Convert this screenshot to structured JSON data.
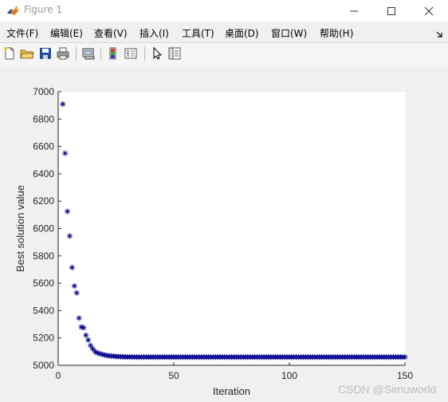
{
  "window": {
    "title": "Figure 1",
    "icon": "matlab-icon",
    "controls": [
      "minimize-icon",
      "maximize-icon",
      "close-icon"
    ]
  },
  "menubar": {
    "items": [
      {
        "label": "文件(F)"
      },
      {
        "label": "编辑(E)"
      },
      {
        "label": "查看(V)"
      },
      {
        "label": "插入(I)"
      },
      {
        "label": "工具(T)"
      },
      {
        "label": "桌面(D)"
      },
      {
        "label": "窗口(W)"
      },
      {
        "label": "帮助(H)"
      }
    ],
    "overflow_icon": "dock-arrow-icon"
  },
  "toolbar": {
    "buttons": [
      {
        "icon": "new-figure-icon"
      },
      {
        "icon": "open-file-icon"
      },
      {
        "icon": "save-icon"
      },
      {
        "icon": "print-icon"
      },
      {
        "icon": "link-plot-icon"
      },
      {
        "icon": "insert-colorbar-icon"
      },
      {
        "icon": "insert-legend-icon"
      },
      {
        "icon": "pointer-icon"
      },
      {
        "icon": "property-inspector-icon"
      }
    ]
  },
  "chart_data": {
    "type": "scatter",
    "marker": "*",
    "marker_color": "#00008b",
    "axes_background": "#ffffff",
    "xlabel": "Iteration",
    "ylabel": "Best solution value",
    "xlim": [
      0,
      150
    ],
    "ylim": [
      5000,
      7000
    ],
    "grid": false,
    "tick_labels": {
      "x": [
        "0",
        "50",
        "100",
        "150"
      ],
      "y": [
        "5000",
        "5200",
        "5400",
        "5600",
        "5800",
        "6000",
        "6200",
        "6400",
        "6600",
        "6800",
        "7000"
      ]
    },
    "series": [
      {
        "x": [
          2,
          3,
          4,
          5,
          6,
          7,
          8,
          9,
          10,
          11,
          12,
          13,
          14,
          15,
          16,
          17,
          18,
          19,
          20,
          21,
          22,
          23,
          24,
          25,
          26,
          27,
          28,
          29,
          30,
          31,
          32,
          33,
          34,
          35,
          36,
          37,
          38,
          39,
          40,
          41,
          42,
          43,
          44,
          45,
          46,
          47,
          48,
          49,
          50,
          51,
          52,
          53,
          54,
          55,
          56,
          57,
          58,
          59,
          60,
          61,
          62,
          63,
          64,
          65,
          66,
          67,
          68,
          69,
          70,
          71,
          72,
          73,
          74,
          75,
          76,
          77,
          78,
          79,
          80,
          81,
          82,
          83,
          84,
          85,
          86,
          87,
          88,
          89,
          90,
          91,
          92,
          93,
          94,
          95,
          96,
          97,
          98,
          99,
          100,
          101,
          102,
          103,
          104,
          105,
          106,
          107,
          108,
          109,
          110,
          111,
          112,
          113,
          114,
          115,
          116,
          117,
          118,
          119,
          120,
          121,
          122,
          123,
          124,
          125,
          126,
          127,
          128,
          129,
          130,
          131,
          132,
          133,
          134,
          135,
          136,
          137,
          138,
          139,
          140,
          141,
          142,
          143,
          144,
          145,
          146,
          147,
          148,
          149,
          150
        ],
        "y": [
          6910,
          6550,
          6125,
          5945,
          5715,
          5580,
          5530,
          5345,
          5280,
          5275,
          5220,
          5185,
          5145,
          5120,
          5100,
          5090,
          5085,
          5080,
          5076,
          5072,
          5070,
          5068,
          5066,
          5065,
          5064,
          5063,
          5062,
          5062,
          5061,
          5061,
          5061,
          5060,
          5060,
          5060,
          5060,
          5060,
          5060,
          5060,
          5060,
          5060,
          5060,
          5060,
          5060,
          5060,
          5060,
          5060,
          5060,
          5060,
          5060,
          5060,
          5060,
          5060,
          5060,
          5060,
          5060,
          5060,
          5060,
          5060,
          5060,
          5060,
          5060,
          5060,
          5060,
          5060,
          5060,
          5060,
          5060,
          5060,
          5060,
          5060,
          5060,
          5060,
          5060,
          5060,
          5060,
          5060,
          5060,
          5060,
          5060,
          5060,
          5060,
          5060,
          5060,
          5060,
          5060,
          5060,
          5060,
          5060,
          5060,
          5060,
          5060,
          5060,
          5060,
          5060,
          5060,
          5060,
          5060,
          5060,
          5060,
          5060,
          5060,
          5060,
          5060,
          5060,
          5060,
          5060,
          5060,
          5060,
          5060,
          5060,
          5060,
          5060,
          5060,
          5060,
          5060,
          5060,
          5060,
          5060,
          5060,
          5060,
          5060,
          5060,
          5060,
          5060,
          5060,
          5060,
          5060,
          5060,
          5060,
          5060,
          5060,
          5060,
          5060,
          5060,
          5060,
          5060,
          5060,
          5060,
          5060,
          5060,
          5060,
          5060,
          5060,
          5060,
          5060,
          5060,
          5060,
          5060,
          5060
        ]
      }
    ]
  },
  "watermark": "CSDN @Simuworld"
}
